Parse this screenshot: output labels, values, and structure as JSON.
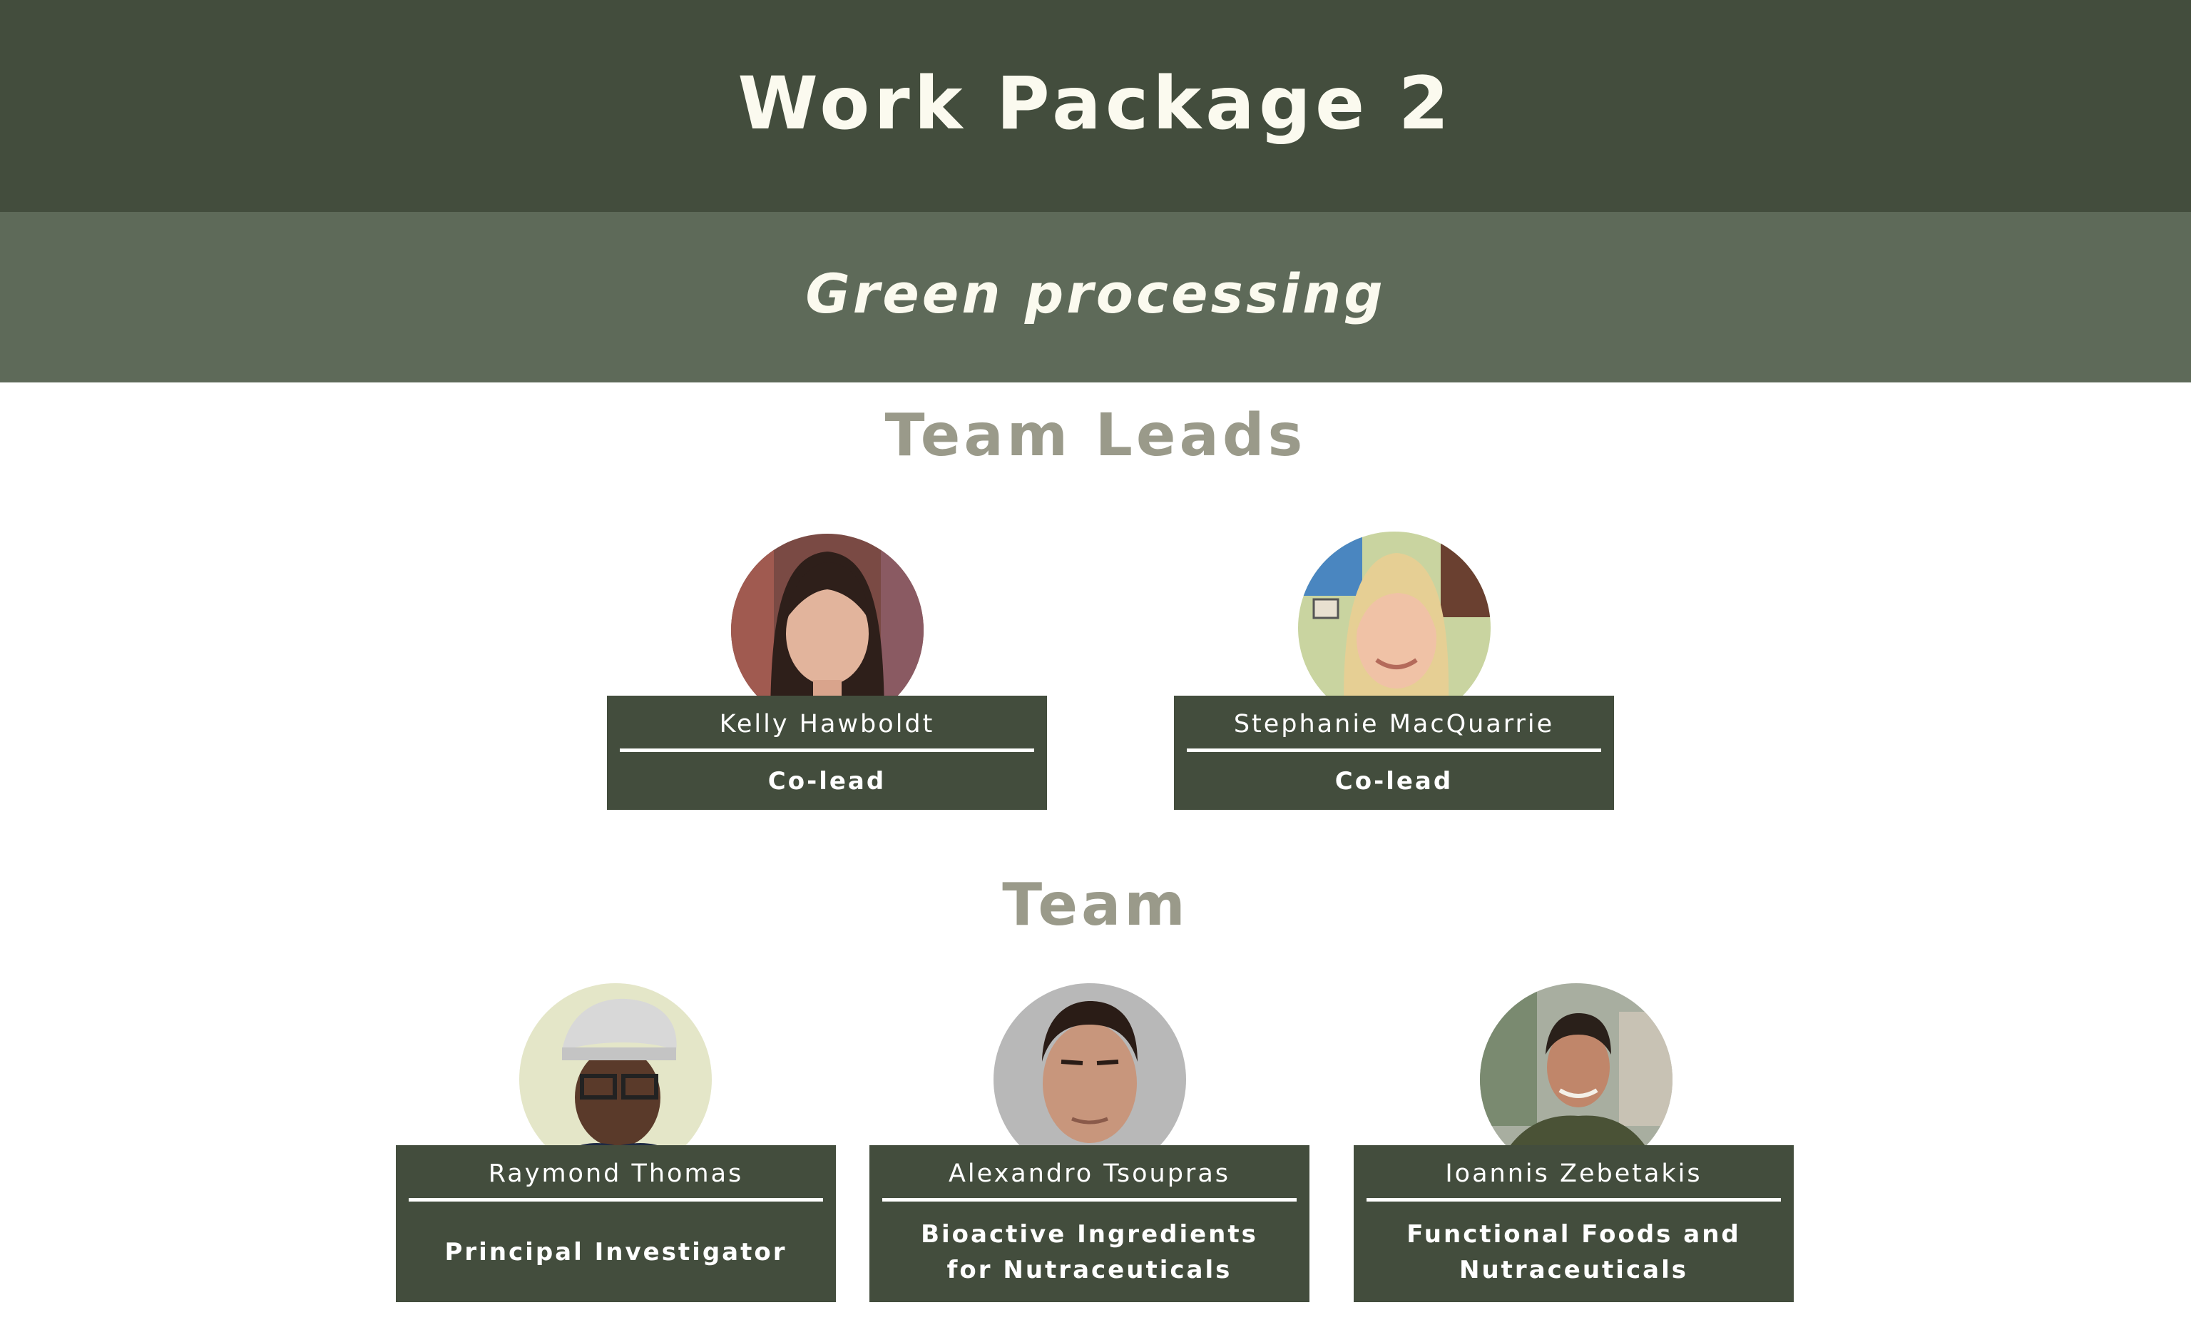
{
  "header": {
    "title": "Work Package 2",
    "subtitle": "Green processing"
  },
  "sections": {
    "leads_heading": "Team Leads",
    "team_heading": "Team"
  },
  "colors": {
    "dark_green": "#434d3d",
    "mid_green": "#5e6a59",
    "heading_gray": "#9a9a8a",
    "text_light": "#fbfaef"
  },
  "leads": [
    {
      "name": "Kelly Hawboldt",
      "role": "Co-lead"
    },
    {
      "name": "Stephanie MacQuarrie",
      "role": "Co-lead"
    }
  ],
  "team": [
    {
      "name": "Raymond Thomas",
      "role": "Principal Investigator"
    },
    {
      "name": "Alexandro Tsoupras",
      "role": "Bioactive Ingredients for Nutraceuticals"
    },
    {
      "name": "Ioannis Zebetakis",
      "role": "Functional Foods and Nutraceuticals"
    }
  ]
}
